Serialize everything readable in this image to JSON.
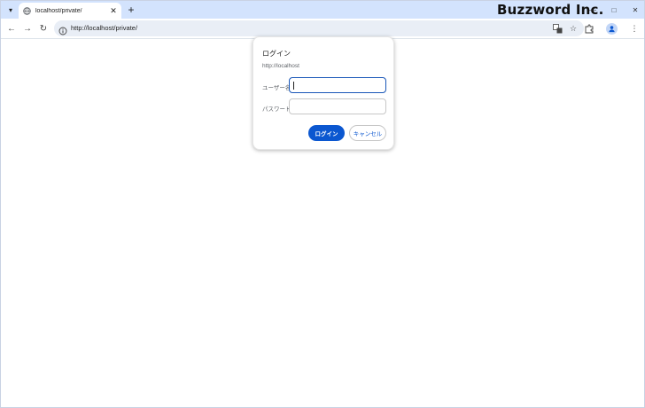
{
  "browser": {
    "tab": {
      "title": "localhost/private/",
      "favicon": "globe-icon"
    },
    "brand": "Buzzword Inc.",
    "address_bar": {
      "url": "http://localhost/private/"
    },
    "icons": {
      "tab_list": "chevron-down-icon",
      "new_tab": "plus-icon",
      "back": "back-arrow-icon",
      "forward": "forward-arrow-icon",
      "reload": "reload-icon",
      "site_info": "info-icon",
      "translate": "translate-icon",
      "bookmark": "star-icon",
      "extensions": "puzzle-icon",
      "profile": "profile-icon",
      "menu": "kebab-menu-icon",
      "minimize": "minimize-icon",
      "maximize": "maximize-icon",
      "close": "close-icon"
    }
  },
  "auth_dialog": {
    "title": "ログイン",
    "origin": "http://localhost",
    "username_label": "ユーザー名",
    "username_value": "",
    "password_label": "パスワード",
    "password_value": "",
    "login_button": "ログイン",
    "cancel_button": "キャンセル"
  },
  "colors": {
    "tabstrip": "#d3e3fd",
    "omnibox": "#e9eef6",
    "accent": "#0b57d0"
  }
}
